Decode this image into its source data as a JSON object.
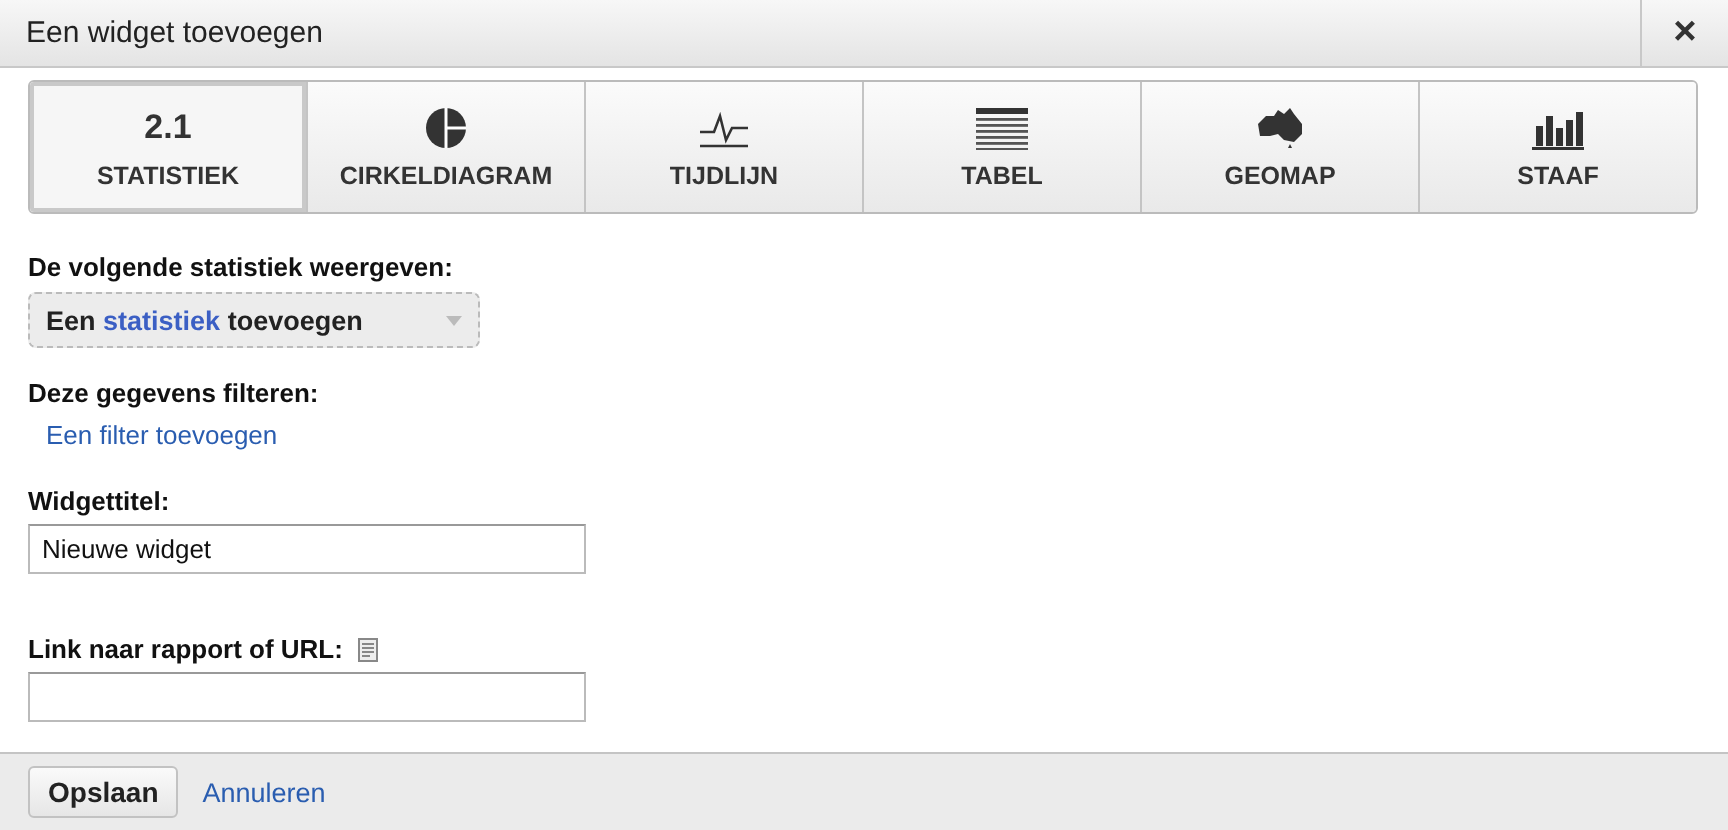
{
  "window": {
    "title": "Een widget toevoegen",
    "close": "×"
  },
  "tabs": [
    {
      "kind": "number",
      "value": "2.1",
      "label": "STATISTIEK",
      "selected": true
    },
    {
      "kind": "pie",
      "label": "CIRKELDIAGRAM",
      "selected": false
    },
    {
      "kind": "timeline",
      "label": "TIJDLIJN",
      "selected": false
    },
    {
      "kind": "table",
      "label": "TABEL",
      "selected": false
    },
    {
      "kind": "map",
      "label": "GEOMAP",
      "selected": false
    },
    {
      "kind": "bars",
      "label": "STAAF",
      "selected": false
    }
  ],
  "metric": {
    "label": "De volgende statistiek weergeven:",
    "dropdown": {
      "before": "Een",
      "highlight": "statistiek",
      "after": "toevoegen"
    }
  },
  "filter": {
    "label": "Deze gegevens filteren:",
    "link": "Een filter toevoegen"
  },
  "widget_title": {
    "label": "Widgettitel:",
    "value": "Nieuwe widget"
  },
  "report_link": {
    "label": "Link naar rapport of URL:"
  },
  "footer": {
    "save": "Opslaan",
    "cancel": "Annuleren"
  }
}
